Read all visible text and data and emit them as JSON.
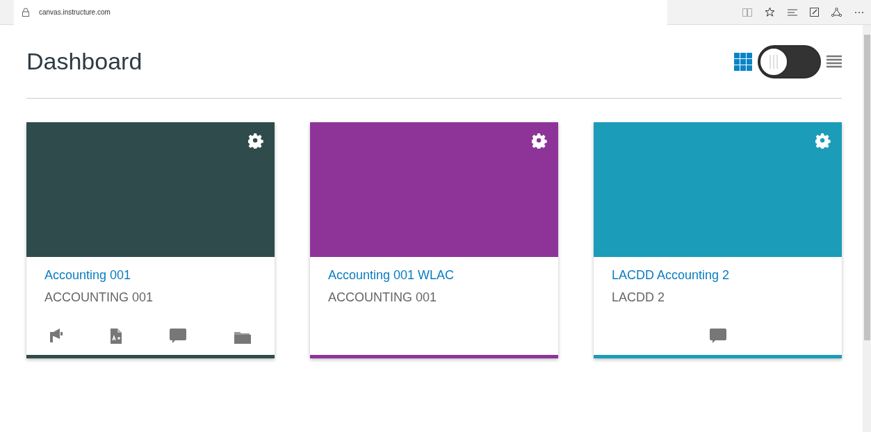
{
  "browser": {
    "url": "canvas.instructure.com"
  },
  "page": {
    "title": "Dashboard"
  },
  "view_options": [
    {
      "kind": "grid",
      "selected": true
    },
    {
      "kind": "list",
      "selected": false
    }
  ],
  "cards": [
    {
      "title": "Accounting 001",
      "subtitle": "ACCOUNTING 001",
      "color": "#304b4b",
      "actions": [
        {
          "kind": "announcements"
        },
        {
          "kind": "assignments"
        },
        {
          "kind": "discussions"
        },
        {
          "kind": "files"
        }
      ]
    },
    {
      "title": "Accounting 001 WLAC",
      "subtitle": "ACCOUNTING 001",
      "color": "#8e3499"
    },
    {
      "title": "LACDD Accounting 2",
      "subtitle": "LACDD 2",
      "color": "#1b9cb8",
      "actions": [
        {
          "kind": "discussions"
        }
      ]
    }
  ]
}
